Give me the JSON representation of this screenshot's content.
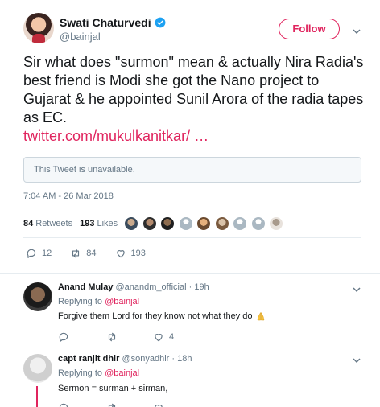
{
  "tweet": {
    "author_name": "Swati Chaturvedi",
    "author_handle": "@bainjal",
    "follow_label": "Follow",
    "text": "Sir what does \"surmon\" mean & actually Nira Radia's best friend is Modi she got the Nano project to Gujarat & he appointed Sunil Arora of the radia tapes as EC.",
    "link": "twitter.com/mukulkanitkar/ …",
    "quote_unavailable": "This Tweet is unavailable.",
    "timestamp": "7:04 AM - 26 Mar 2018",
    "retweets_count": "84",
    "retweets_label": "Retweets",
    "likes_count": "193",
    "likes_label": "Likes",
    "actions": {
      "replies": "12",
      "retweets": "84",
      "likes": "193"
    }
  },
  "replies": [
    {
      "name": "Anand Mulay",
      "handle": "@anandm_official",
      "time": "· 19h",
      "replying_prefix": "Replying to",
      "replying_to": "@bainjal",
      "text": "Forgive them Lord for they know not what they do",
      "likes": "4"
    },
    {
      "name": "capt ranjit dhir",
      "handle": "@sonyadhir",
      "time": "· 18h",
      "replying_prefix": "Replying to",
      "replying_to": "@bainjal",
      "text": "Sermon = surman + sirman,"
    }
  ],
  "colors": {
    "accent": "#e0245e",
    "verified": "#1da1f2",
    "secondary_text": "#657786"
  }
}
